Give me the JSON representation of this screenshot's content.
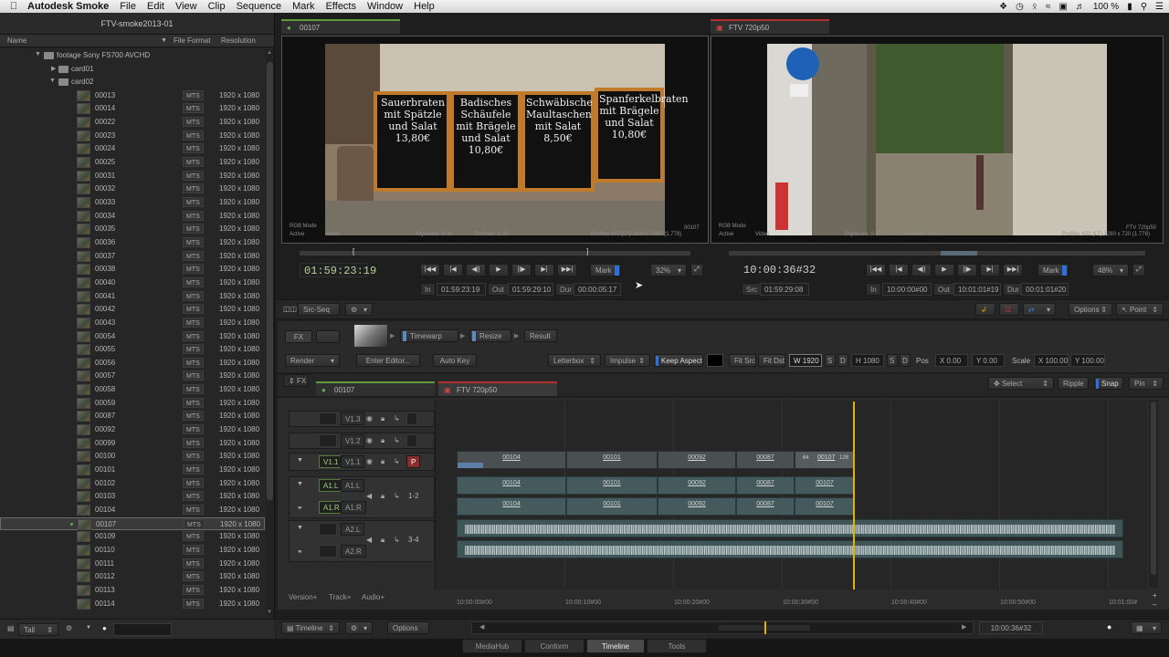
{
  "menubar": {
    "app_name": "Autodesk Smoke",
    "items": [
      "File",
      "Edit",
      "View",
      "Clip",
      "Sequence",
      "Mark",
      "Effects",
      "Window",
      "Help"
    ],
    "battery": "100 %"
  },
  "library": {
    "title": "FTV-smoke2013-01",
    "columns": {
      "name": "Name",
      "format": "File Format",
      "resolution": "Resolution"
    },
    "folder": "footage Sony FS700 AVCHD",
    "card01": "card01",
    "card02": "card02",
    "clips": [
      {
        "name": "00013",
        "format": "MTS",
        "res": "1920 x 1080"
      },
      {
        "name": "00014",
        "format": "MTS",
        "res": "1920 x 1080"
      },
      {
        "name": "00022",
        "format": "MTS",
        "res": "1920 x 1080"
      },
      {
        "name": "00023",
        "format": "MTS",
        "res": "1920 x 1080"
      },
      {
        "name": "00024",
        "format": "MTS",
        "res": "1920 x 1080"
      },
      {
        "name": "00025",
        "format": "MTS",
        "res": "1920 x 1080"
      },
      {
        "name": "00031",
        "format": "MTS",
        "res": "1920 x 1080"
      },
      {
        "name": "00032",
        "format": "MTS",
        "res": "1920 x 1080"
      },
      {
        "name": "00033",
        "format": "MTS",
        "res": "1920 x 1080"
      },
      {
        "name": "00034",
        "format": "MTS",
        "res": "1920 x 1080"
      },
      {
        "name": "00035",
        "format": "MTS",
        "res": "1920 x 1080"
      },
      {
        "name": "00036",
        "format": "MTS",
        "res": "1920 x 1080"
      },
      {
        "name": "00037",
        "format": "MTS",
        "res": "1920 x 1080"
      },
      {
        "name": "00038",
        "format": "MTS",
        "res": "1920 x 1080"
      },
      {
        "name": "00040",
        "format": "MTS",
        "res": "1920 x 1080"
      },
      {
        "name": "00041",
        "format": "MTS",
        "res": "1920 x 1080"
      },
      {
        "name": "00042",
        "format": "MTS",
        "res": "1920 x 1080"
      },
      {
        "name": "00043",
        "format": "MTS",
        "res": "1920 x 1080"
      },
      {
        "name": "00054",
        "format": "MTS",
        "res": "1920 x 1080"
      },
      {
        "name": "00055",
        "format": "MTS",
        "res": "1920 x 1080"
      },
      {
        "name": "00056",
        "format": "MTS",
        "res": "1920 x 1080"
      },
      {
        "name": "00057",
        "format": "MTS",
        "res": "1920 x 1080"
      },
      {
        "name": "00058",
        "format": "MTS",
        "res": "1920 x 1080"
      },
      {
        "name": "00059",
        "format": "MTS",
        "res": "1920 x 1080"
      },
      {
        "name": "00087",
        "format": "MTS",
        "res": "1920 x 1080"
      },
      {
        "name": "00092",
        "format": "MTS",
        "res": "1920 x 1080"
      },
      {
        "name": "00099",
        "format": "MTS",
        "res": "1920 x 1080"
      },
      {
        "name": "00100",
        "format": "MTS",
        "res": "1920 x 1080"
      },
      {
        "name": "00101",
        "format": "MTS",
        "res": "1920 x 1080"
      },
      {
        "name": "00102",
        "format": "MTS",
        "res": "1920 x 1080"
      },
      {
        "name": "00103",
        "format": "MTS",
        "res": "1920 x 1080"
      },
      {
        "name": "00104",
        "format": "MTS",
        "res": "1920 x 1080"
      },
      {
        "name": "00107",
        "format": "MTS",
        "res": "1920 x 1080"
      },
      {
        "name": "00109",
        "format": "MTS",
        "res": "1920 x 1080"
      },
      {
        "name": "00110",
        "format": "MTS",
        "res": "1920 x 1080"
      },
      {
        "name": "00111",
        "format": "MTS",
        "res": "1920 x 1080"
      },
      {
        "name": "00112",
        "format": "MTS",
        "res": "1920 x 1080"
      },
      {
        "name": "00113",
        "format": "MTS",
        "res": "1920 x 1080"
      },
      {
        "name": "00114",
        "format": "MTS",
        "res": "1920 x 1080"
      }
    ],
    "selected": "00107",
    "view_mode": "Tall"
  },
  "source_viewer": {
    "tab": "00107",
    "mode": "RGB Mode",
    "active": "Active",
    "video": "Video",
    "exposure": "Exposure: 0.00",
    "contrast": "Contrast: 1.00",
    "clip_id": "00107",
    "format_info": "ProRes 422 (LT) 1920 x 1080 (1.778)",
    "timecode": "01:59:23:19",
    "mark": "Mark",
    "zoom": "32%",
    "in_label": "In",
    "in_tc": "01:59:23:19",
    "out_label": "Out",
    "out_tc": "01:59:29:10",
    "dur_label": "Dur",
    "dur_tc": "00:00:05:17",
    "signs": [
      "Sauerbraten mit Spätzle und Salat 13,80€",
      "Badisches Schäufele mit Brägele und Salat 10,80€",
      "Schwäbische Maultaschen mit Salat 8,50€",
      "Spanferkelbraten mit Brägele und Salat 10,80€"
    ]
  },
  "record_viewer": {
    "tab": "FTV 720p50",
    "mode": "RGB Mode",
    "active": "Active",
    "video": "Video",
    "exposure": "Exposure: 0.00",
    "contrast": "Contrast: 1.00",
    "clip_id": "FTV 720p50",
    "format_info": "ProRes 422 (LT) 1280 x 720 (1.778)",
    "timecode": "10:00:36#32",
    "src_label": "Src",
    "src_tc": "01:59:29:08",
    "mark": "Mark",
    "zoom": "48%",
    "in_label": "In",
    "in_tc": "10:00:00#00",
    "out_label": "Out",
    "out_tc": "10:01:01#19",
    "dur_label": "Dur",
    "dur_tc": "00:01:01#20"
  },
  "toolbar": {
    "src_seq": "Src-Seq",
    "options": "Options",
    "point": "Point"
  },
  "fx": {
    "fx_label": "FX",
    "nodes": [
      "Timewarp",
      "Resize",
      "Result"
    ],
    "render": "Render",
    "enter_editor": "Enter Editor...",
    "auto_key": "Auto Key",
    "letterbox": "Letterbox",
    "impulse": "Impulse",
    "keep_aspect": "Keep Aspect",
    "fit_src": "Fit Src",
    "fit_dst": "Fit Dst",
    "w": "W 1920",
    "s1": "S",
    "d1": "D",
    "h": "H 1080",
    "s2": "S",
    "d2": "D",
    "pos": "Pos",
    "x": "X 0.00",
    "y": "Y 0.00",
    "scale": "Scale",
    "sx": "X 100.00",
    "sy": "Y 100.00"
  },
  "timeline": {
    "fx_toggle": "FX",
    "tab_source": "00107",
    "tab_record": "FTV 720p50",
    "select": "Select",
    "ripple": "Ripple",
    "snap": "Snap",
    "pin": "Pin",
    "tracks": {
      "v13": "V1.3",
      "v12": "V1.2",
      "v11a": "V1.1",
      "v11b": "V1.1",
      "p": "P",
      "a1l": "A1.L",
      "a1l_b": "A1.L",
      "a1r": "A1.R",
      "a1r_b": "A1.R",
      "a12": "1-2",
      "a2l": "A2.L",
      "a2r": "A2.R",
      "a34": "3-4"
    },
    "video_clips": [
      "00104",
      "00101",
      "00092",
      "00087",
      "00107"
    ],
    "clip_extra": [
      "64",
      "128"
    ],
    "ruler": [
      "10:00:00#00",
      "10:00:10#00",
      "10:00:20#00",
      "10:00:30#00",
      "10:00:40#00",
      "10:00:50#00",
      "10:01:00#"
    ],
    "version_btn": "Version+",
    "track_btn": "Track+",
    "audio_btn": "Audio+",
    "mode": "Timeline",
    "options": "Options",
    "current_tc": "10:00:36#32"
  },
  "bottom_tabs": [
    "MediaHub",
    "Conform",
    "Timeline",
    "Tools"
  ],
  "active_tab": "Timeline"
}
